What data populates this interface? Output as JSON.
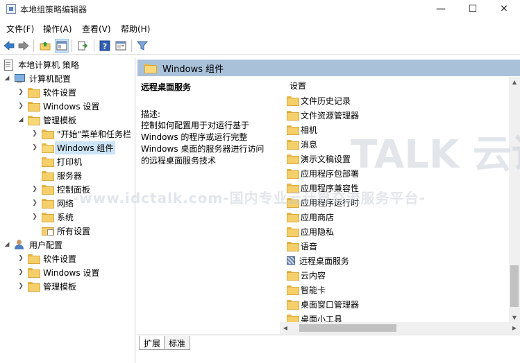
{
  "window": {
    "title": "本地组策略编辑器",
    "min": "—",
    "max": "☐",
    "close": "✕"
  },
  "menu": [
    "文件(F)",
    "操作(A)",
    "查看(V)",
    "帮助(H)"
  ],
  "toolbar": {
    "icons": [
      "back-icon",
      "forward-icon",
      "up-folder-icon",
      "show-tree-icon",
      "export-icon",
      "help-icon",
      "properties-icon",
      "filter-icon"
    ]
  },
  "tree": {
    "root": "本地计算机 策略",
    "computer_config": "计算机配置",
    "software_settings_1": "软件设置",
    "windows_settings_1": "Windows 设置",
    "admin_templates_1": "管理模板",
    "start_menu": "\"开始\"菜单和任务栏",
    "windows_components": "Windows 组件",
    "printers": "打印机",
    "server": "服务器",
    "control_panel": "控制面板",
    "network": "网络",
    "system": "系统",
    "all_settings": "所有设置",
    "user_config": "用户配置",
    "software_settings_2": "软件设置",
    "windows_settings_2": "Windows 设置",
    "admin_templates_2": "管理模板"
  },
  "right": {
    "header": "Windows 组件",
    "desc_title": "远程桌面服务",
    "desc_label": "描述:",
    "desc_text": "控制如何配置用于对运行基于 Windows 的程序或运行完整 Windows 桌面的服务器进行访问的远程桌面服务技术",
    "column_header": "设置",
    "items": [
      "文件历史记录",
      "文件资源管理器",
      "相机",
      "消息",
      "演示文稿设置",
      "应用程序包部署",
      "应用程序兼容性",
      "应用程序运行时",
      "应用商店",
      "应用隐私",
      "语音",
      "远程桌面服务",
      "云内容",
      "智能卡",
      "桌面窗口管理器",
      "桌面小工具"
    ]
  },
  "tabs": {
    "extended": "扩展",
    "standard": "标准"
  },
  "watermark": {
    "big": "TALK 云说",
    "small": "-www.idctalk.com-国内专业云计算交流服务平台-"
  }
}
